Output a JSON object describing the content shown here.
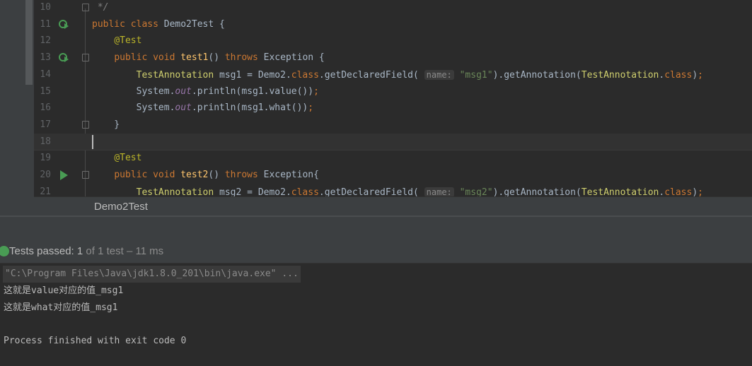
{
  "editor": {
    "lines": [
      {
        "n": "10",
        "code": "<span class='cm'> */</span>"
      },
      {
        "n": "11",
        "code": "<span class='kw'>public class </span>Demo2Test {"
      },
      {
        "n": "12",
        "code": "    <span class='an'>@Test</span>"
      },
      {
        "n": "13",
        "code": "    <span class='kw'>public void </span><span style='color:#ffc66d'>test1</span>() <span class='kw'>throws </span>Exception {"
      },
      {
        "n": "14",
        "code": "        <span class='ty'>TestAnnotation</span> msg1 = Demo2.<span class='kw'>class</span>.getDeclaredField( <span class='hint'>name:</span> <span class='st'>\"msg1\"</span>).getAnnotation(<span class='ty'>TestAnnotation</span>.<span class='kw'>class</span>)<span class='kw'>;</span>"
      },
      {
        "n": "15",
        "code": "        System.<span class='it'>out</span>.println(msg1.value())<span class='kw'>;</span>"
      },
      {
        "n": "16",
        "code": "        System.<span class='it'>out</span>.println(msg1.what())<span class='kw'>;</span>"
      },
      {
        "n": "17",
        "code": "    }"
      },
      {
        "n": "18",
        "code": ""
      },
      {
        "n": "19",
        "code": "    <span class='an'>@Test</span>"
      },
      {
        "n": "20",
        "code": "    <span class='kw'>public void </span><span style='color:#ffc66d'>test2</span>() <span class='kw'>throws </span>Exception{"
      },
      {
        "n": "21",
        "code": "        <span class='ty'>TestAnnotation</span> msg2 = Demo2.<span class='kw'>class</span>.getDeclaredField( <span class='hint'>name:</span> <span class='st'>\"msg2\"</span>).getAnnotation(<span class='ty'>TestAnnotation</span>.<span class='kw'>class</span>)<span class='kw'>;</span>"
      }
    ]
  },
  "tab": {
    "label": "Demo2Test"
  },
  "status": {
    "passed": "Tests passed:",
    "count": "1",
    "rest": "of 1 test – 11 ms",
    "icon": "check-circle-icon",
    "color": "#499c54"
  },
  "console": {
    "command": "\"C:\\Program Files\\Java\\jdk1.8.0_201\\bin\\java.exe\" ...",
    "out1": "这就是value对应的值_msg1",
    "out2": "这就是what对应的值_msg1",
    "exit": "Process finished with exit code 0"
  }
}
